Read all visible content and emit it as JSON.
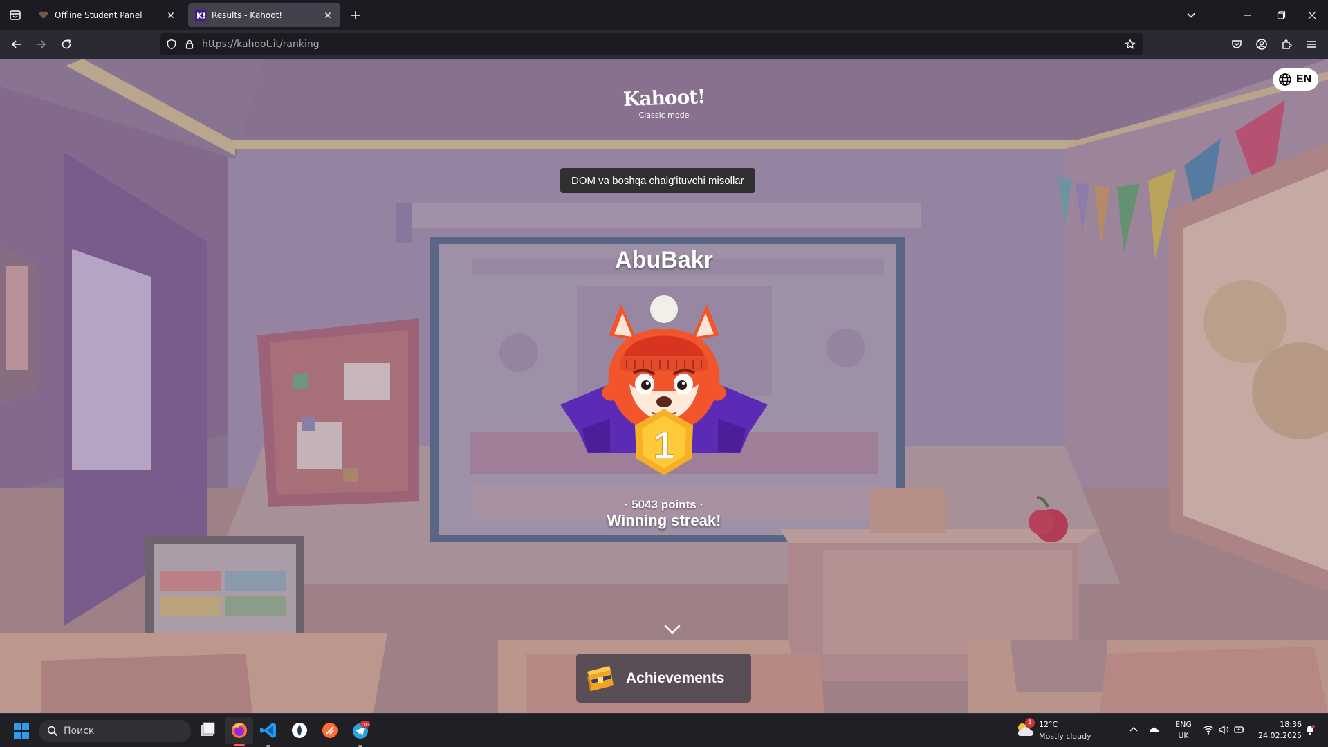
{
  "browser": {
    "tabs": [
      {
        "title": "Offline Student Panel",
        "active": false
      },
      {
        "title": "Results - Kahoot!",
        "active": true
      }
    ],
    "url": {
      "scheme_host": "https://kahoot.it",
      "path": "/ranking"
    }
  },
  "page": {
    "logo": {
      "wordmark": "Kahoot!",
      "mode": "Classic mode"
    },
    "language": {
      "code": "EN",
      "icon": "globe-icon"
    },
    "quiz_title": "DOM va boshqa chalg'ituvchi misollar",
    "player": {
      "name": "AbuBakr",
      "rank": "1",
      "points": "· 5043 points ·",
      "streak": "Winning streak!"
    },
    "achievements_label": "Achievements",
    "colors": {
      "scene_tint": "#8a6f8f",
      "podium_purple": "#5c2bb5",
      "medal_gold": "#f5b027",
      "fox_orange": "#f2552c",
      "hat_red": "#d9341f"
    }
  },
  "taskbar": {
    "search_placeholder": "Поиск",
    "apps": [
      "file-explorer-icon",
      "firefox-icon",
      "vscode-icon",
      "git-client-icon",
      "postman-icon",
      "telegram-icon"
    ],
    "telegram_badge": "103",
    "weather": {
      "temp": "12°C",
      "condition": "Mostly cloudy",
      "badge": "1"
    },
    "input_lang": {
      "line1": "ENG",
      "line2": "UK"
    },
    "clock": {
      "time": "18:36",
      "date": "24.02.2025"
    }
  }
}
